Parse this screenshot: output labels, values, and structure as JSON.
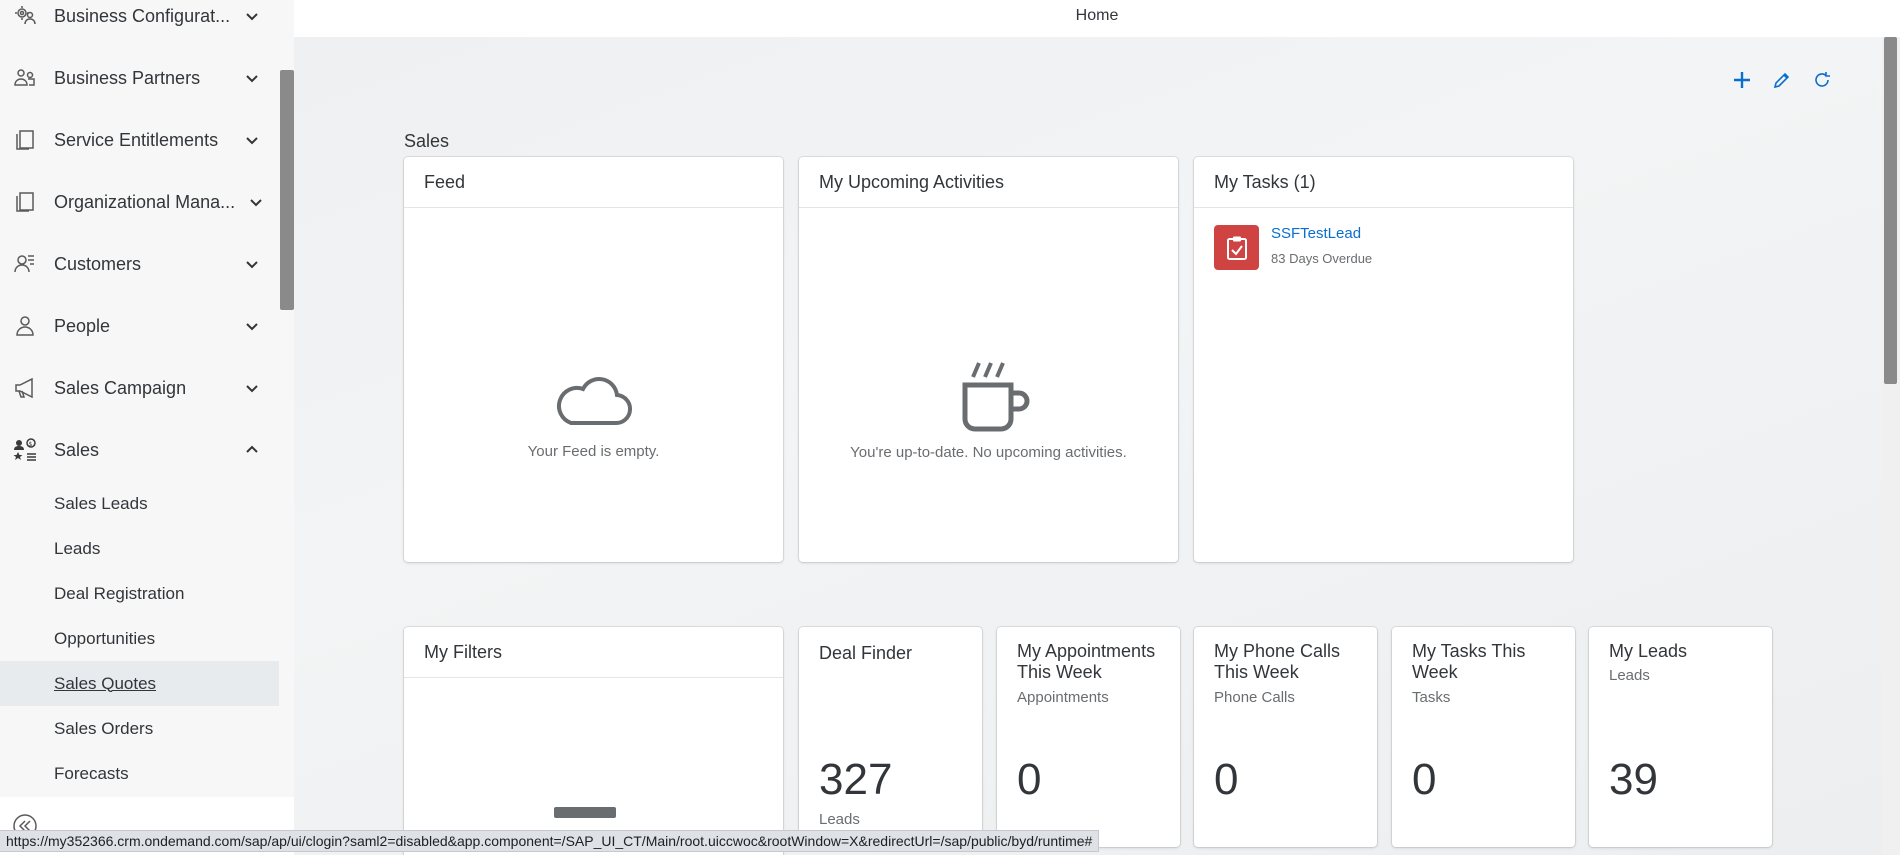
{
  "topbar": {
    "title": "Home"
  },
  "sidebar": {
    "items": [
      {
        "label": "Business Configurat...",
        "icon": "gear-people-icon"
      },
      {
        "label": "Business Partners",
        "icon": "partners-icon"
      },
      {
        "label": "Service Entitlements",
        "icon": "documents-icon"
      },
      {
        "label": "Organizational Mana...",
        "icon": "documents-icon"
      },
      {
        "label": "Customers",
        "icon": "customers-icon"
      },
      {
        "label": "People",
        "icon": "person-icon"
      },
      {
        "label": "Sales Campaign",
        "icon": "megaphone-icon"
      },
      {
        "label": "Sales",
        "icon": "sales-icon"
      }
    ],
    "sub_items": [
      {
        "label": "Sales Leads"
      },
      {
        "label": "Leads"
      },
      {
        "label": "Deal Registration"
      },
      {
        "label": "Opportunities"
      },
      {
        "label": "Sales Quotes"
      },
      {
        "label": "Sales Orders"
      },
      {
        "label": "Forecasts"
      }
    ]
  },
  "main": {
    "section_title": "Sales",
    "feed": {
      "title": "Feed",
      "empty_text": "Your Feed is empty."
    },
    "activities": {
      "title": "My Upcoming Activities",
      "empty_text": "You're up-to-date. No upcoming activities."
    },
    "tasks": {
      "title": "My Tasks (1)",
      "task_name": "SSFTestLead",
      "task_meta": "83 Days Overdue",
      "task_color": "#d04343"
    },
    "filters": {
      "title": "My Filters"
    },
    "tiles": [
      {
        "title": "Deal Finder",
        "subtitle": "",
        "number": "327",
        "unit": "Leads"
      },
      {
        "title": "My Appointments This Week",
        "subtitle": "Appointments",
        "number": "0",
        "unit": ""
      },
      {
        "title": "My Phone Calls This Week",
        "subtitle": "Phone Calls",
        "number": "0",
        "unit": ""
      },
      {
        "title": "My Tasks This Week",
        "subtitle": "Tasks",
        "number": "0",
        "unit": ""
      },
      {
        "title": "My Leads",
        "subtitle": "Leads",
        "number": "39",
        "unit": ""
      }
    ]
  },
  "statusbar": {
    "url": "https://my352366.crm.ondemand.com/sap/ap/ui/clogin?saml2=disabled&app.component=/SAP_UI_CT/Main/root.uiccwoc&rootWindow=X&redirectUrl=/sap/public/byd/runtime#"
  },
  "colors": {
    "accent": "#0a6ed1",
    "task_overdue": "#d04343"
  }
}
